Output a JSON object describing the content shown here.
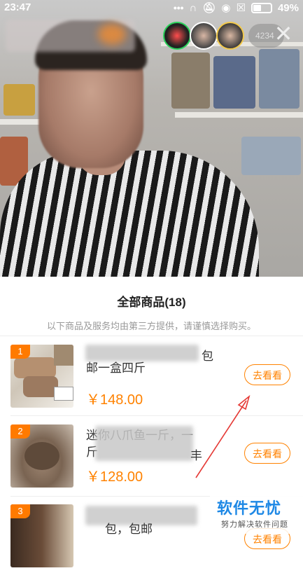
{
  "status_bar": {
    "time": "23:47",
    "battery": "49%"
  },
  "live": {
    "viewer_count": "4234"
  },
  "sheet": {
    "title": "全部商品(18)",
    "notice": "以下商品及服务均由第三方提供，请谨慎选择购买。"
  },
  "items": [
    {
      "rank": "1",
      "title_visible": "邮一盒四斤",
      "title_tail": "包",
      "price": "￥148.00",
      "button": "去看看"
    },
    {
      "rank": "2",
      "title_line1": "迷你八爪鱼一斤，一",
      "title_line2": "斤",
      "title_tail": "丰",
      "price": "￥128.00",
      "button": "去看看"
    },
    {
      "rank": "3",
      "title_line1": "包，包邮",
      "button": "去看看"
    }
  ],
  "watermark": {
    "main": "软件无忧",
    "sub": "努力解决软件问题"
  },
  "colors": {
    "accent": "#ff8200",
    "watermark_blue": "#1e88e5"
  }
}
